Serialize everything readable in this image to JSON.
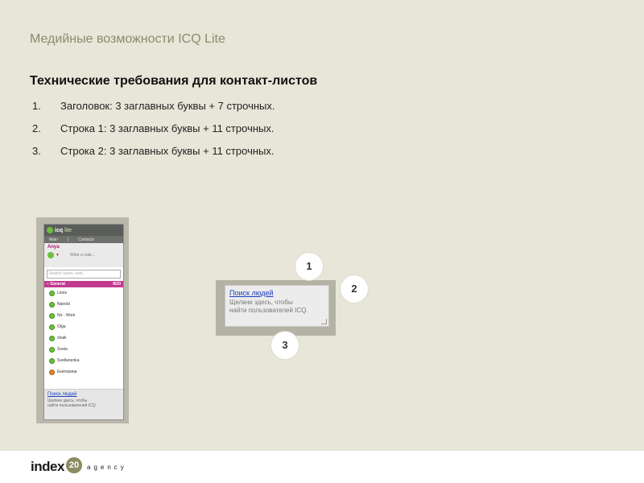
{
  "slide": {
    "title": "Медийные возможности ICQ Lite",
    "subtitle": "Технические требования для контакт-листов",
    "requirements": [
      {
        "num": "1.",
        "text": "Заголовок: 3 заглавных буквы + 7 строчных."
      },
      {
        "num": "2.",
        "text": "Строка 1: 3 заглавных буквы + 11 строчных."
      },
      {
        "num": "3.",
        "text": "Строка 2: 3 заглавных буквы + 11 строчных."
      }
    ]
  },
  "contact_list": {
    "brand": "icq",
    "brand_suffix": "lite",
    "menu": [
      "Main",
      "|",
      "Contacts"
    ],
    "user_name": "Anya",
    "note_placeholder": "Write a note...",
    "search_placeholder": "Search users, web...",
    "group": {
      "name": "General",
      "count": "8/20"
    },
    "contacts": [
      {
        "name": "Lenis",
        "status": "online"
      },
      {
        "name": "Nairobi",
        "status": "online"
      },
      {
        "name": "Nir - Work",
        "status": "online"
      },
      {
        "name": "Olga",
        "status": "online"
      },
      {
        "name": "shaik",
        "status": "online"
      },
      {
        "name": "Sveta",
        "status": "online"
      },
      {
        "name": "Svetlanenka",
        "status": "online"
      },
      {
        "name": "Екатерина",
        "status": "away"
      }
    ],
    "promo": {
      "link": "Поиск людей",
      "line1": "Щелкни здесь, чтобы",
      "line2": "найти пользователей ICQ."
    }
  },
  "banner": {
    "link": "Поиск людей",
    "line1": "Щелкни здесь, чтобы",
    "line2": "найти пользователей ICQ."
  },
  "callouts": [
    "1",
    "2",
    "3"
  ],
  "footer": {
    "logo_word": "index",
    "logo_badge": "20",
    "logo_suffix": "agency"
  },
  "colors": {
    "slide_bg": "#e7e6d8",
    "title_color": "#8c8a6e",
    "group_header": "#c23a8f",
    "link": "#1c3fbf"
  }
}
